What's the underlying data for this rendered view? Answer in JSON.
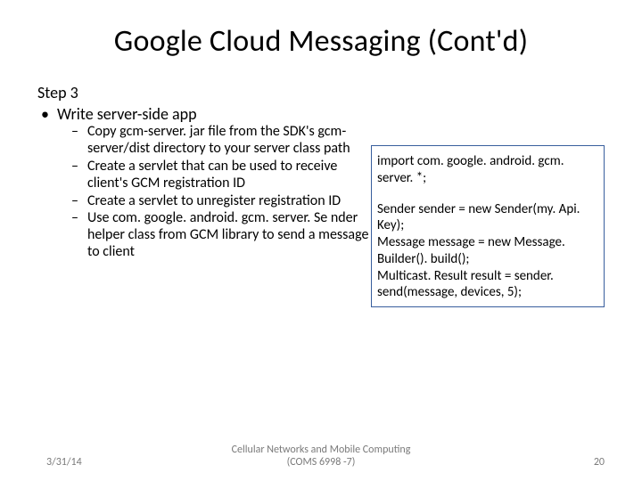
{
  "title": "Google Cloud Messaging (Cont'd)",
  "step_label": "Step 3",
  "bullet1": "Write server-side app",
  "sub": {
    "i1": "Copy gcm-server. jar file from the SDK's gcm-server/dist directory to your server class path",
    "i2": "Create a servlet that can be used to receive client's GCM registration ID",
    "i3": "Create a servlet to unregister registration ID",
    "i4": "Use com. google. android. gcm. server. Se nder helper class from GCM library to send a message to client"
  },
  "code": {
    "l1": "import com. google. android. gcm. server. *;",
    "l2": "Sender sender = new Sender(my. Api. Key);",
    "l3": "Message message = new Message. Builder(). build();",
    "l4": "Multicast. Result result = sender. send(message, devices, 5);"
  },
  "footer": {
    "date": "3/31/14",
    "center1": "Cellular Networks and Mobile Computing",
    "center2": "(COMS 6998 -7)",
    "page": "20"
  }
}
